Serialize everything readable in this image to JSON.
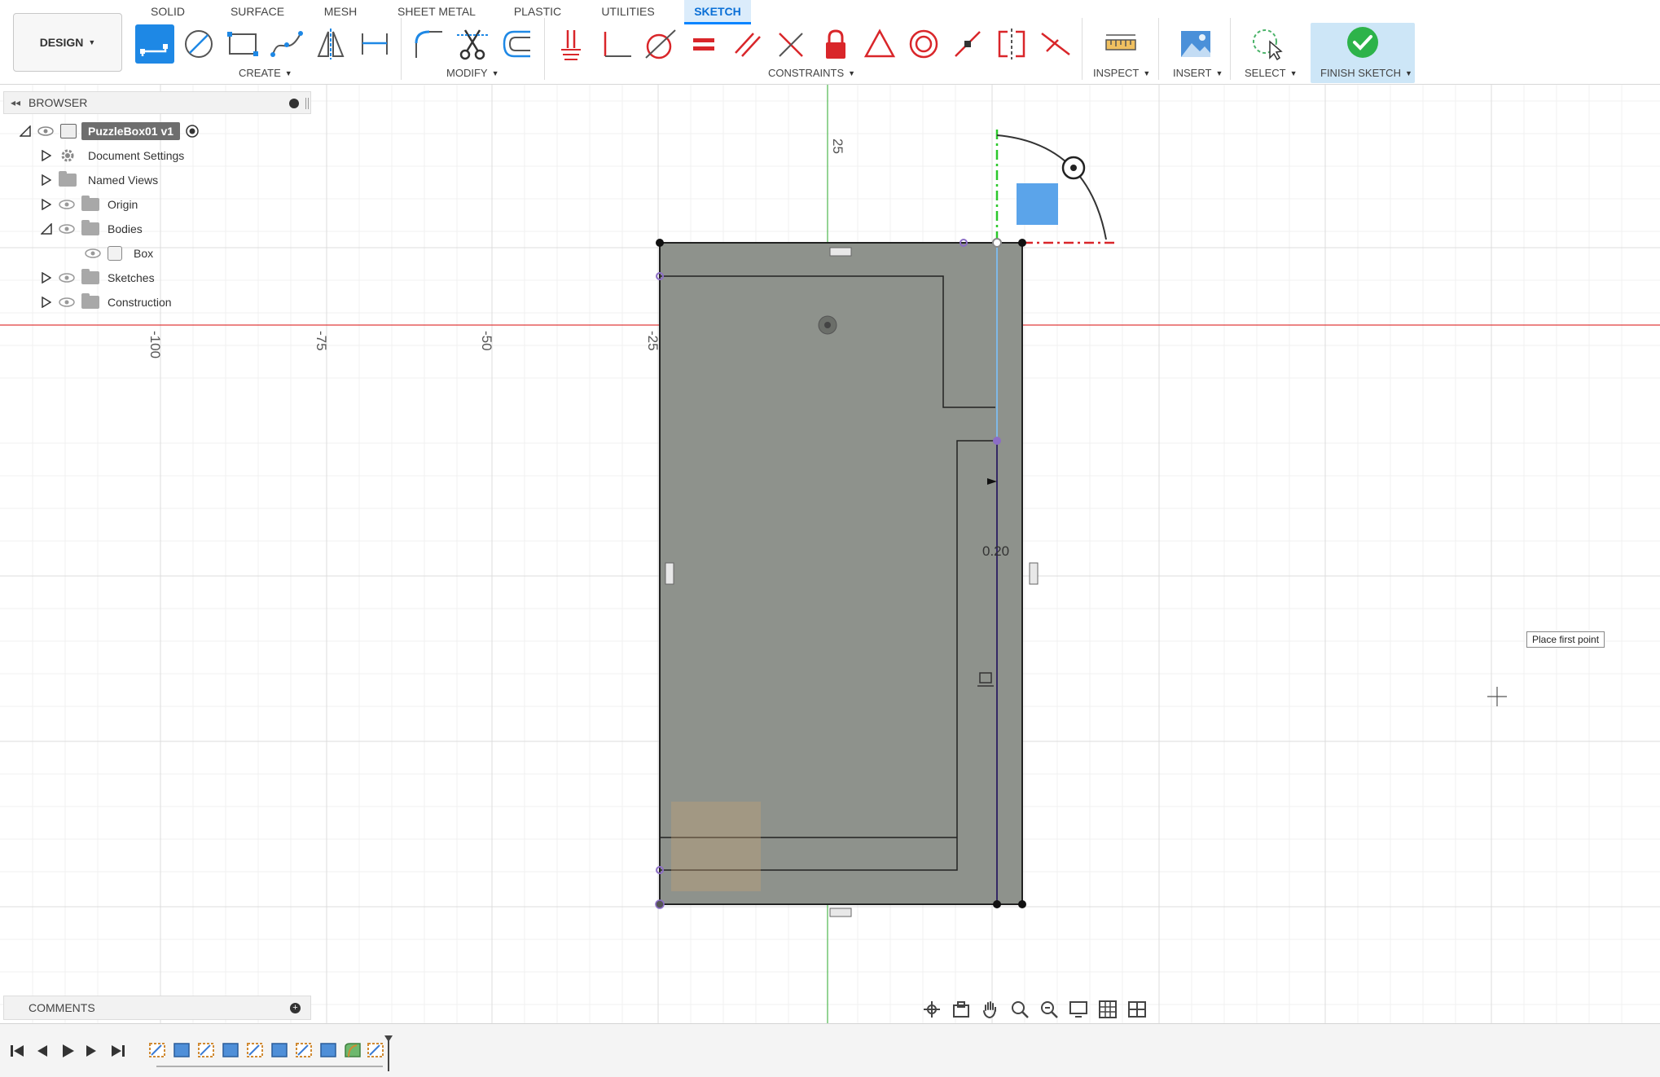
{
  "toolbar": {
    "workspace_label": "DESIGN",
    "tabs": [
      "SOLID",
      "SURFACE",
      "MESH",
      "SHEET METAL",
      "PLASTIC",
      "UTILITIES",
      "SKETCH"
    ],
    "active_tab": "SKETCH",
    "groups": {
      "create": "CREATE",
      "modify": "MODIFY",
      "constraints": "CONSTRAINTS",
      "inspect": "INSPECT",
      "insert": "INSERT",
      "select": "SELECT",
      "finish": "FINISH SKETCH"
    },
    "tools": {
      "create": [
        "line-icon",
        "circle-icon",
        "rectangle-icon",
        "spline-icon",
        "mirror-icon",
        "dimension-icon"
      ],
      "modify": [
        "fillet-icon",
        "trim-icon",
        "offset-icon"
      ],
      "constraints": [
        "coincident-icon",
        "perpendicular-icon",
        "tangent-icon",
        "equal-icon",
        "parallel-icon",
        "perpendicular-x-icon",
        "fix-icon",
        "triangle-icon",
        "concentric-icon",
        "midpoint-icon",
        "symmetry-icon",
        "collinear-icon"
      ]
    }
  },
  "browser": {
    "title": "BROWSER",
    "root": "PuzzleBox01 v1",
    "items": [
      {
        "label": "Document Settings",
        "icon": "gear-icon"
      },
      {
        "label": "Named Views",
        "icon": "folder-icon"
      },
      {
        "label": "Origin",
        "icon": "folder-icon"
      },
      {
        "label": "Bodies",
        "icon": "folder-icon"
      },
      {
        "label": "Box",
        "icon": "body-icon"
      },
      {
        "label": "Sketches",
        "icon": "folder-icon"
      },
      {
        "label": "Construction",
        "icon": "folder-icon"
      }
    ]
  },
  "canvas": {
    "axis_labels": [
      "-100",
      "-75",
      "-50",
      "-25",
      "25"
    ],
    "dimension_value": "0.20",
    "tooltip": "Place first point"
  },
  "comments": {
    "title": "COMMENTS"
  },
  "colors": {
    "accent": "#0a84ff",
    "finish_green": "#2db34a",
    "constraint_red": "#d9262a",
    "sketch_gray": "#8e928c",
    "x_axis": "#e03c3c",
    "y_axis": "#4db84d"
  }
}
